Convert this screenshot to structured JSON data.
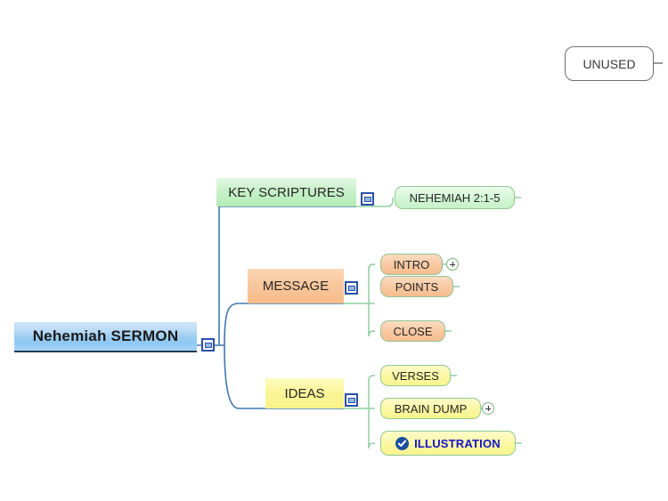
{
  "app": {
    "title": "Nehemiah SERMON mind map",
    "background": "#ffffff"
  },
  "colors": {
    "root_fill": "#9ccdf2",
    "root_rule": "#1f3a52",
    "green_fill": "#c8f0c9",
    "orange_fill": "#f9c79c",
    "yellow_fill": "#fbf59a",
    "trunk_line": "#3f78ad",
    "branch_line": "#8fd0a0",
    "illustration_text": "#1414c8",
    "check_badge": "#1a4fa0",
    "unused_border": "#6e6e6e"
  },
  "root": {
    "label": "Nehemiah SERMON",
    "note_icon": "note-icon"
  },
  "floating": {
    "unused": {
      "label": "UNUSED"
    }
  },
  "branches": [
    {
      "id": "key-scriptures",
      "label": "KEY SCRIPTURES",
      "color": "green",
      "note_icon": "note-icon",
      "children": [
        {
          "label": "NEHEMIAH 2:1-5",
          "color": "green",
          "expand": false
        }
      ]
    },
    {
      "id": "message",
      "label": "MESSAGE",
      "color": "orange",
      "note_icon": "note-icon",
      "children": [
        {
          "label": "INTRO",
          "color": "orange",
          "expand": true
        },
        {
          "label": "POINTS",
          "color": "orange",
          "expand": false
        },
        {
          "label": "CLOSE",
          "color": "orange",
          "expand": false
        }
      ]
    },
    {
      "id": "ideas",
      "label": "IDEAS",
      "color": "yellow",
      "note_icon": "note-icon",
      "children": [
        {
          "label": "VERSES",
          "color": "yellow",
          "expand": false
        },
        {
          "label": "BRAIN DUMP",
          "color": "yellow",
          "expand": true
        },
        {
          "label": "ILLUSTRATION",
          "color": "yellow",
          "expand": false,
          "badge": "check-circle-icon",
          "emphasis": true
        }
      ]
    }
  ]
}
